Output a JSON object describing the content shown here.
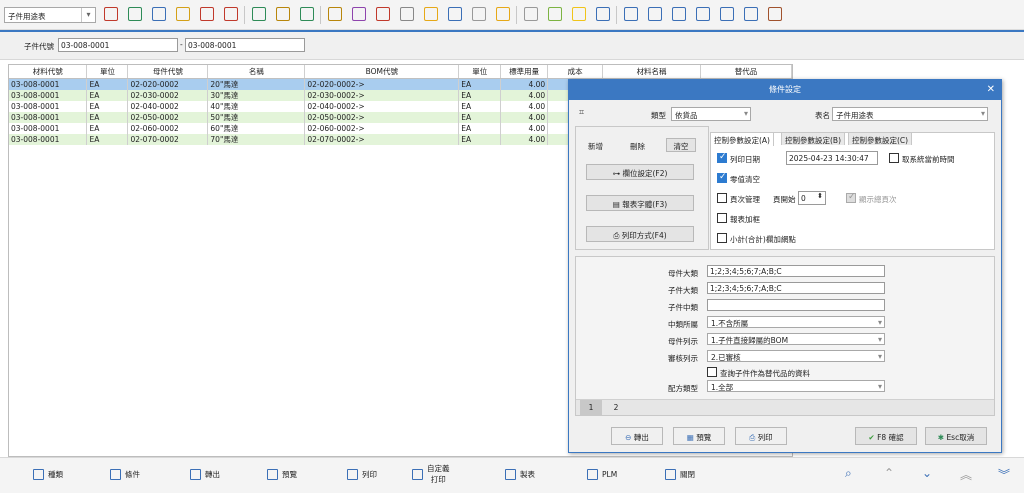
{
  "toolbar": {
    "report_select": "子件用途表",
    "icons": [
      "print-preview-icon",
      "phone-icon",
      "computer-icon",
      "lock-icon",
      "briefcase-icon",
      "home-icon",
      "dollar-icon",
      "money-bag-icon",
      "cart-icon",
      "clipboard-icon",
      "users-icon",
      "link-icon",
      "help-icon",
      "mail-icon",
      "info-icon",
      "calculator-icon",
      "folder-icon",
      "notes-icon",
      "ok-icon",
      "bell-icon",
      "search-icon",
      "org-chart-icon",
      "monitor-icon",
      "refresh-icon",
      "window-icon",
      "close-window-icon",
      "picture-icon",
      "exit-icon"
    ]
  },
  "filter": {
    "label": "子件代號",
    "from_value": "03-008-0001",
    "separator": "-",
    "to_value": "03-008-0001"
  },
  "grid": {
    "columns": [
      "材料代號",
      "單位",
      "母件代號",
      "名稱",
      "BOM代號",
      "單位",
      "標準用量",
      "成本",
      "材料名稱",
      "替代品"
    ],
    "rows": [
      {
        "material": "03-008-0001",
        "unit": "EA",
        "parent": "02-020-0002",
        "name": "20\"馬達",
        "bom": "02-020-0002->",
        "unit2": "EA",
        "qty": "4.00",
        "cost": "",
        "mname": "",
        "sub": ""
      },
      {
        "material": "03-008-0001",
        "unit": "EA",
        "parent": "02-030-0002",
        "name": "30\"馬達",
        "bom": "02-030-0002->",
        "unit2": "EA",
        "qty": "4.00",
        "cost": "",
        "mname": "",
        "sub": ""
      },
      {
        "material": "03-008-0001",
        "unit": "EA",
        "parent": "02-040-0002",
        "name": "40\"馬達",
        "bom": "02-040-0002->",
        "unit2": "EA",
        "qty": "4.00",
        "cost": "",
        "mname": "",
        "sub": ""
      },
      {
        "material": "03-008-0001",
        "unit": "EA",
        "parent": "02-050-0002",
        "name": "50\"馬達",
        "bom": "02-050-0002->",
        "unit2": "EA",
        "qty": "4.00",
        "cost": "",
        "mname": "",
        "sub": ""
      },
      {
        "material": "03-008-0001",
        "unit": "EA",
        "parent": "02-060-0002",
        "name": "60\"馬達",
        "bom": "02-060-0002->",
        "unit2": "EA",
        "qty": "4.00",
        "cost": "",
        "mname": "",
        "sub": ""
      },
      {
        "material": "03-008-0001",
        "unit": "EA",
        "parent": "02-070-0002",
        "name": "70\"馬達",
        "bom": "02-070-0002->",
        "unit2": "EA",
        "qty": "4.00",
        "cost": "",
        "mname": "",
        "sub": ""
      }
    ]
  },
  "dialog": {
    "title": "條件設定",
    "close": "✕",
    "type_label": "類型",
    "type_value": "依貨品",
    "table_name_label": "表名",
    "table_name_value": "子件用途表",
    "actions": {
      "add": "新增",
      "delete": "刪除",
      "clear": "清空"
    },
    "side_buttons": {
      "column_settings": "欄位設定(F2)",
      "report_font": "報表字體(F3)",
      "print_mode": "列印方式(F4)"
    },
    "tabs": [
      "控制參數設定(A)",
      "控制參數設定(B)",
      "控制參數設定(C)"
    ],
    "options": {
      "print_date": {
        "label": "列印日期",
        "checked": true
      },
      "date_value": "2025-04-23 14:30:47",
      "use_system_time": {
        "label": "取系統當前時間",
        "checked": false
      },
      "zero_clear": {
        "label": "零值清空",
        "checked": true
      },
      "page_manage": {
        "label": "頁次管理",
        "checked": false
      },
      "page_start_label": "頁開始",
      "page_start_value": "0",
      "show_total_pages": {
        "label": "顯示總頁次",
        "checked": true
      },
      "report_frame": {
        "label": "報表加框",
        "checked": false
      },
      "subtotal_grid": {
        "label": "小計(合計)欄加網點",
        "checked": false
      }
    },
    "fields": {
      "parent_major_label": "母件大類",
      "parent_major_value": "1;2;3;4;5;6;7;A;B;C",
      "child_major_label": "子件大類",
      "child_major_value": "1;2;3;4;5;6;7;A;B;C",
      "child_mid_label": "子件中類",
      "child_mid_value": "",
      "mid_belong_label": "中類所屬",
      "mid_belong_value": "1.不含所屬",
      "parent_list_label": "母件列示",
      "parent_list_value": "1.子件直接歸屬的BOM",
      "audit_list_label": "審核列示",
      "audit_list_value": "2.已審核",
      "query_sub_label": "查詢子件作為替代品的資料",
      "formula_type_label": "配方類型",
      "formula_type_value": "1.全部"
    },
    "pages": [
      "1",
      "2"
    ],
    "footer": {
      "export": "轉出",
      "preview": "預覽",
      "print": "列印",
      "confirm": "F8 確認",
      "cancel": "Esc取消"
    }
  },
  "statusbar": {
    "items": [
      "種類",
      "條件",
      "轉出",
      "預覽",
      "列印",
      "自定義\n打印",
      "製表",
      "PLM",
      "關閉"
    ]
  }
}
